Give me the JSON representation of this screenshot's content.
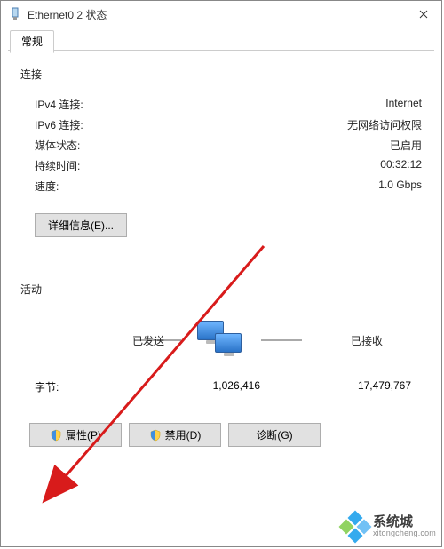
{
  "titlebar": {
    "title": "Ethernet0 2 状态"
  },
  "tab": {
    "general": "常规"
  },
  "connection": {
    "header": "连接",
    "ipv4_label": "IPv4 连接:",
    "ipv4_value": "Internet",
    "ipv6_label": "IPv6 连接:",
    "ipv6_value": "无网络访问权限",
    "media_label": "媒体状态:",
    "media_value": "已启用",
    "duration_label": "持续时间:",
    "duration_value": "00:32:12",
    "speed_label": "速度:",
    "speed_value": "1.0 Gbps",
    "details_btn": "详细信息(E)..."
  },
  "activity": {
    "header": "活动",
    "sent_label": "已发送",
    "recv_label": "已接收",
    "bytes_label": "字节:",
    "bytes_sent": "1,026,416",
    "bytes_recv": "17,479,767"
  },
  "buttons": {
    "properties": "属性(P)",
    "disable": "禁用(D)",
    "diagnose": "诊断(G)"
  },
  "watermark": {
    "zh": "系统城",
    "py": "xitongcheng.com"
  }
}
